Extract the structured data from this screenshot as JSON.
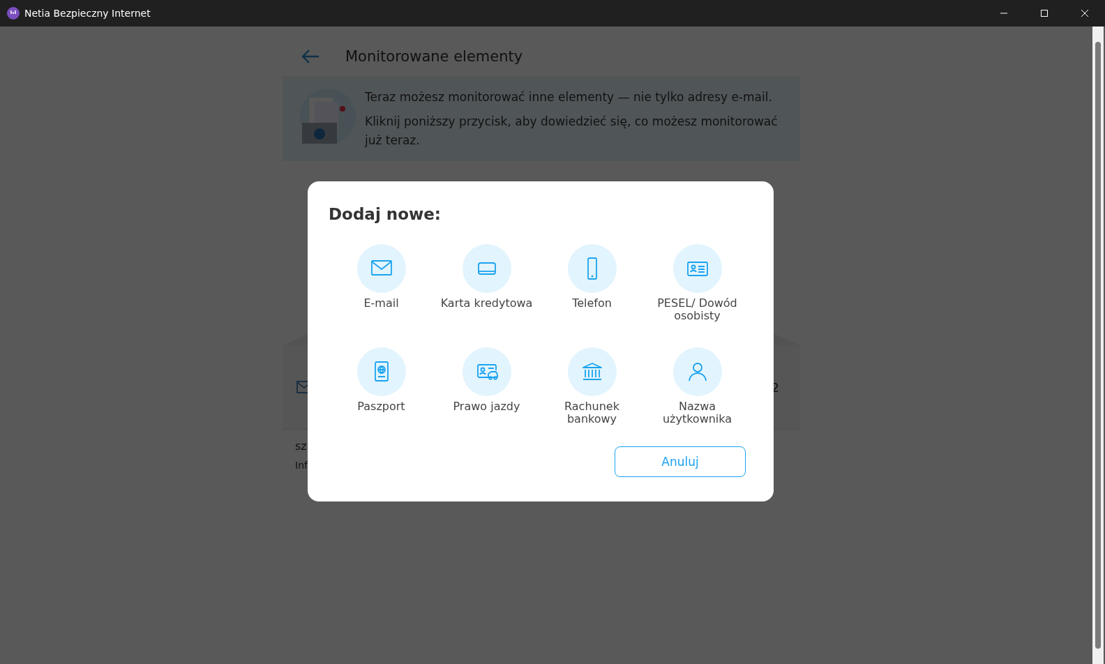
{
  "window": {
    "title": "Netia Bezpieczny Internet"
  },
  "page": {
    "title": "Monitorowane elementy",
    "banner": [
      "Teraz możesz monitorować inne elementy — nie tylko adresy e-mail.",
      "Kliknij poniższy przycisk, aby dowiedzieć się, co możesz monitorować już teraz."
    ],
    "row_value": "2",
    "footer_lines": [
      "sz",
      "Inf"
    ]
  },
  "dialog": {
    "title": "Dodaj nowe:",
    "items": [
      {
        "kind": "email",
        "label": "E-mail"
      },
      {
        "kind": "card",
        "label": "Karta kredytowa"
      },
      {
        "kind": "phone",
        "label": "Telefon"
      },
      {
        "kind": "id",
        "label": "PESEL/ Dowód osobisty"
      },
      {
        "kind": "passport",
        "label": "Paszport"
      },
      {
        "kind": "license",
        "label": "Prawo jazdy"
      },
      {
        "kind": "bank",
        "label": "Rachunek bankowy"
      },
      {
        "kind": "user",
        "label": "Nazwa użytkownika"
      }
    ],
    "cancel": "Anuluj"
  }
}
